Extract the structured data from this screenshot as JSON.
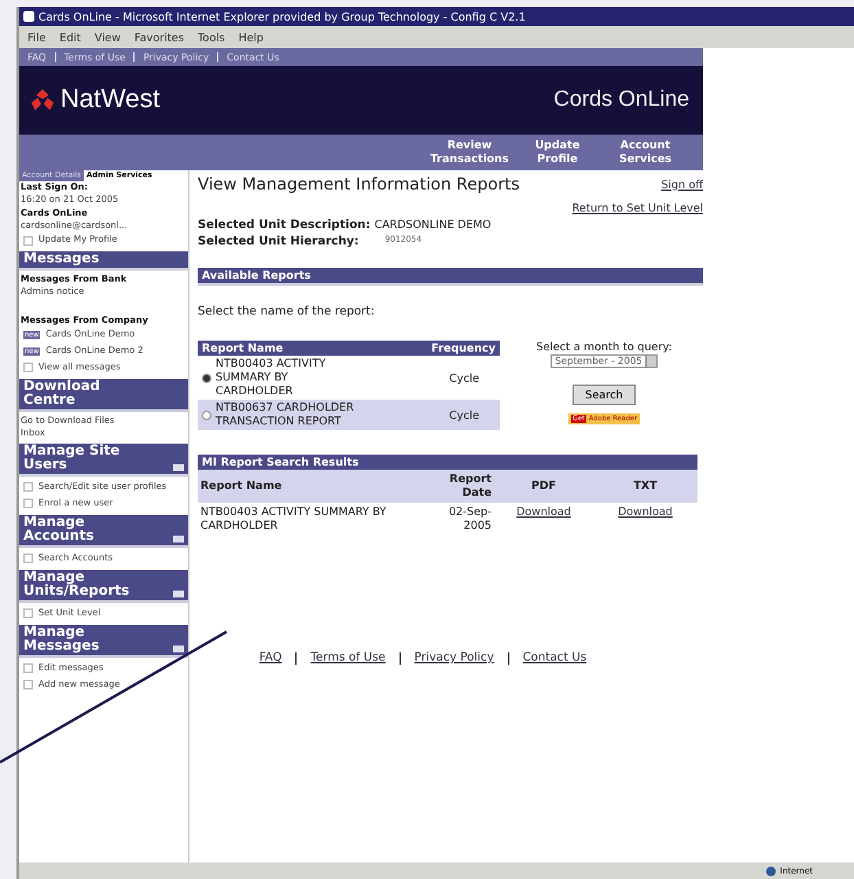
{
  "window": {
    "title": "Cards OnLine - Microsoft Internet Explorer provided by Group Technology - Config C V2.1"
  },
  "menu": [
    "File",
    "Edit",
    "View",
    "Favorites",
    "Tools",
    "Help"
  ],
  "top_links": [
    "FAQ",
    "Terms of Use",
    "Privacy Policy",
    "Contact Us"
  ],
  "header": {
    "logo": "NatWest",
    "product": "Cords OnLine"
  },
  "nav": [
    "Review Transactions",
    "Update Profile",
    "Account Services"
  ],
  "sidebar": {
    "tabs": [
      {
        "label": "Account Details",
        "selected": false
      },
      {
        "label": "Admin Services",
        "selected": true
      }
    ],
    "last_sign_on": "Last Sign On:",
    "sign_on_time": "16:20 on 21 Oct 2005",
    "user": "Cards OnLine",
    "email": "cardsonline@cardsonl...",
    "update_profile": "Update My Profile",
    "sections": [
      {
        "title": "Messages",
        "toggle": false,
        "items": [
          {
            "kind": "label",
            "text": "Messages From Bank"
          },
          {
            "kind": "text",
            "text": "Admins notice"
          },
          {
            "kind": "gap"
          },
          {
            "kind": "label",
            "text": "Messages From Company"
          },
          {
            "kind": "new",
            "badge": "new",
            "text": "Cards OnLine Demo"
          },
          {
            "kind": "new",
            "badge": "new",
            "text": "Cards OnLine Demo 2"
          },
          {
            "kind": "link",
            "text": "View all messages"
          }
        ]
      },
      {
        "title": "Download Centre",
        "toggle": false,
        "items": [
          {
            "kind": "text",
            "text": "Go to Download Files"
          },
          {
            "kind": "text",
            "text": "Inbox"
          }
        ]
      },
      {
        "title": "Manage Site Users",
        "toggle": true,
        "items": [
          {
            "kind": "link",
            "text": "Search/Edit site user profiles"
          },
          {
            "kind": "link",
            "text": "Enrol a new user"
          }
        ]
      },
      {
        "title": "Manage Accounts",
        "toggle": true,
        "items": [
          {
            "kind": "link",
            "text": "Search Accounts"
          }
        ]
      },
      {
        "title": "Manage Units/Reports",
        "toggle": true,
        "items": [
          {
            "kind": "link",
            "text": "Set Unit Level"
          }
        ]
      },
      {
        "title": "Manage Messages",
        "toggle": true,
        "items": [
          {
            "kind": "link",
            "text": "Edit messages"
          },
          {
            "kind": "link",
            "text": "Add new message"
          }
        ]
      }
    ]
  },
  "main": {
    "title": "View Management Information Reports",
    "sign_off": "Sign off",
    "return_link": "Return to Set Unit Level",
    "unit_description": {
      "label": "Selected Unit Description:",
      "value": "CARDSONLINE DEMO"
    },
    "unit_hierarchy": {
      "label": "Selected Unit Hierarchy:",
      "value": "9012054"
    },
    "available_heading": "Available Reports",
    "prompt": "Select the name of the report:",
    "reports": {
      "columns": [
        "Report Name",
        "Frequency"
      ],
      "rows": [
        {
          "name": "NTB00403 ACTIVITY SUMMARY BY CARDHOLDER",
          "frequency": "Cycle",
          "selected": true
        },
        {
          "name": "NTB00637 CARDHOLDER TRANSACTION REPORT",
          "frequency": "Cycle",
          "selected": false
        }
      ]
    },
    "month_label": "Select a month to query:",
    "month": "September - 2005",
    "search_button": "Search",
    "reader_badge": {
      "get": "Get",
      "name": "Adobe Reader"
    },
    "results": {
      "heading": "MI Report Search Results",
      "columns": [
        "Report Name",
        "Report Date",
        "PDF",
        "TXT"
      ],
      "rows": [
        {
          "name": "NTB00403 ACTIVITY SUMMARY BY CARDHOLDER",
          "date": "02-Sep-2005",
          "pdf": "Download",
          "txt": "Download"
        }
      ]
    },
    "footer_links": [
      "FAQ",
      "Terms of Use",
      "Privacy Policy",
      "Contact Us"
    ]
  },
  "status_bar": {
    "zone": "Internet"
  }
}
